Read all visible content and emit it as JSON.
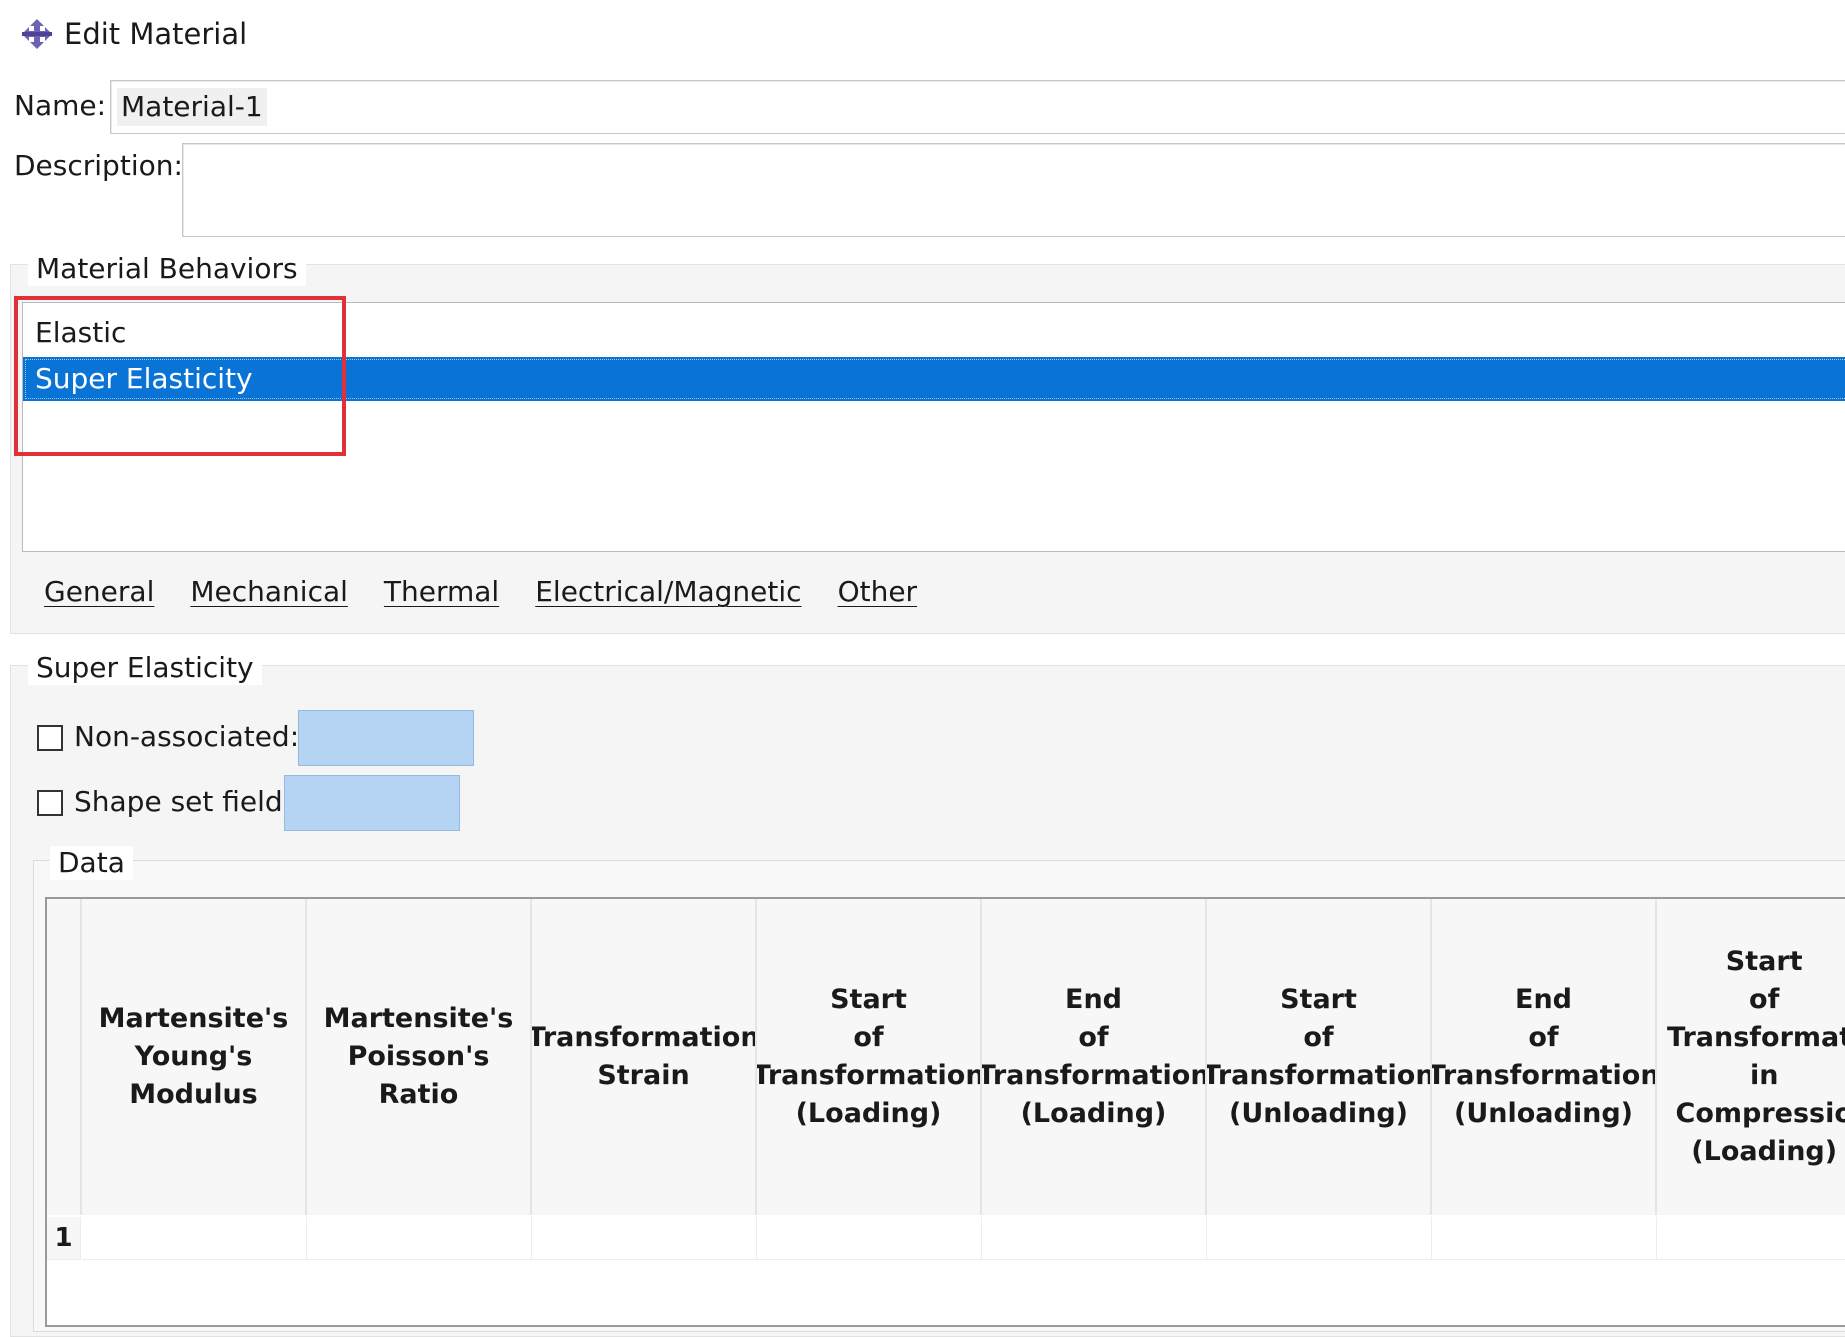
{
  "window": {
    "title": "Edit Material",
    "icon": "cross-arrows-icon"
  },
  "name": {
    "label": "Name:",
    "value": "Material-1"
  },
  "description": {
    "label": "Description:",
    "value": ""
  },
  "behaviors": {
    "group_label": "Material Behaviors",
    "items": [
      {
        "label": "Elastic",
        "selected": false
      },
      {
        "label": "Super Elasticity",
        "selected": true
      }
    ],
    "menus": [
      "General",
      "Mechanical",
      "Thermal",
      "Electrical/Magnetic",
      "Other"
    ]
  },
  "super_elasticity": {
    "group_label": "Super Elasticity",
    "non_associated": {
      "label": "Non-associated:",
      "checked": false
    },
    "shape_set_field": {
      "label": "Shape set field:",
      "checked": false
    }
  },
  "data": {
    "group_label": "Data",
    "columns": [
      "Martensite's\nYoung's\nModulus",
      "Martensite's\nPoisson's\nRatio",
      "Transformation\nStrain",
      "Start\nof\nTransformation\n(Loading)",
      "End\nof\nTransformation\n(Loading)",
      "Start\nof\nTransformation\n(Unloading)",
      "End\nof\nTransformation\n(Unloading)",
      "Start\nof\nTransformati\nin\nCompressio\n(Loading)"
    ],
    "rows": [
      {
        "index": "1"
      }
    ]
  },
  "colors": {
    "selection": "#0a74d6",
    "highlight": "#e0313a",
    "field_blue": "#b5d3f3"
  }
}
